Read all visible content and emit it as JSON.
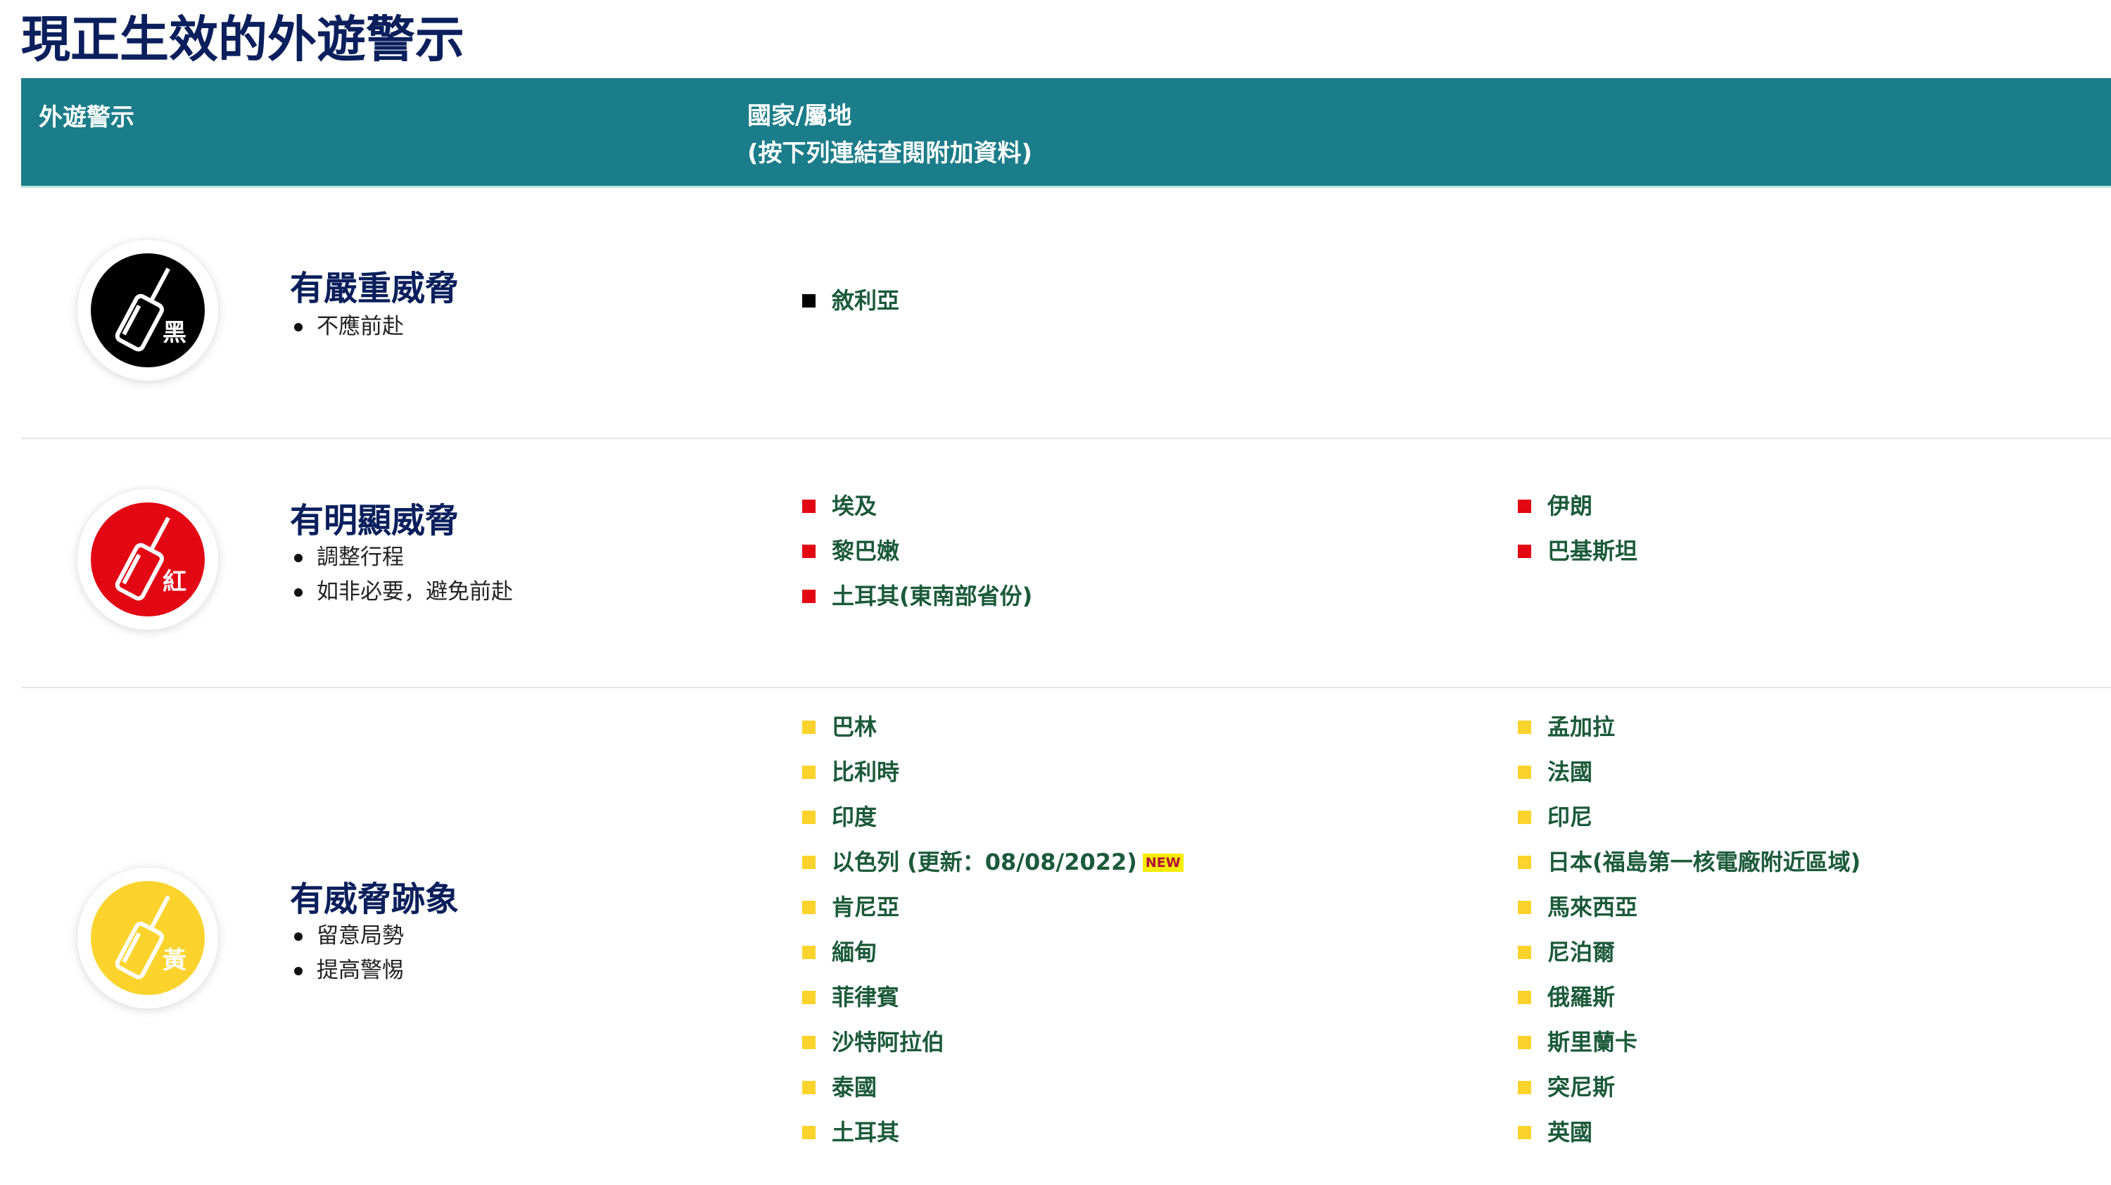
{
  "page": {
    "title": "現正生效的外遊警示"
  },
  "table_header": {
    "col_level": "外遊警示",
    "col_countries_line1": "國家/屬地",
    "col_countries_line2": "(按下列連結查閱附加資料)",
    "background_color": "#1b7d8a"
  },
  "levels": [
    {
      "key": "black",
      "badge_char": "黑",
      "color": "#000000",
      "title": "有嚴重威脅",
      "advice": [
        "不應前赴"
      ],
      "countries": [
        {
          "name": "敘利亞"
        }
      ]
    },
    {
      "key": "red",
      "badge_char": "紅",
      "color": "#e30613",
      "title": "有明顯威脅",
      "advice": [
        "調整行程",
        "如非必要，避免前赴"
      ],
      "countries": [
        {
          "name": "埃及"
        },
        {
          "name": "黎巴嫩"
        },
        {
          "name": "土耳其(東南部省份)"
        },
        {
          "name": "伊朗"
        },
        {
          "name": "巴基斯坦"
        }
      ]
    },
    {
      "key": "amber",
      "badge_char": "黃",
      "color": "#fbd32c",
      "title": "有威脅跡象",
      "advice": [
        "留意局勢",
        "提高警惕"
      ],
      "countries": [
        {
          "name": "巴林"
        },
        {
          "name": "比利時"
        },
        {
          "name": "印度"
        },
        {
          "name": "以色列 (更新：08/08/2022)",
          "tag": "NEW"
        },
        {
          "name": "肯尼亞"
        },
        {
          "name": "緬甸"
        },
        {
          "name": "菲律賓"
        },
        {
          "name": "沙特阿拉伯"
        },
        {
          "name": "泰國"
        },
        {
          "name": "土耳其"
        },
        {
          "name": "孟加拉"
        },
        {
          "name": "法國"
        },
        {
          "name": "印尼"
        },
        {
          "name": "日本(福島第一核電廠附近區域)"
        },
        {
          "name": "馬來西亞"
        },
        {
          "name": "尼泊爾"
        },
        {
          "name": "俄羅斯"
        },
        {
          "name": "斯里蘭卡"
        },
        {
          "name": "突尼斯"
        },
        {
          "name": "英國"
        }
      ]
    }
  ]
}
